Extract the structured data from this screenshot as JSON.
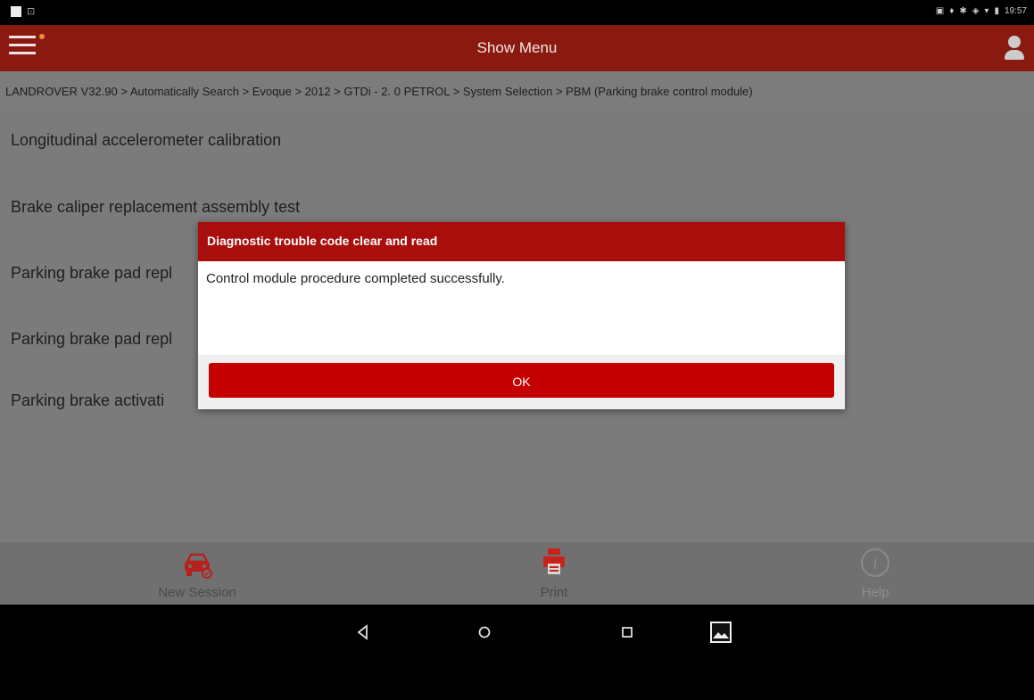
{
  "status_bar": {
    "time": "19:57"
  },
  "app_bar": {
    "title": "Show Menu"
  },
  "breadcrumb": "LANDROVER V32.90 > Automatically Search > Evoque > 2012 > GTDi - 2. 0 PETROL > System Selection > PBM (Parking brake control module)",
  "menu": {
    "items": [
      {
        "label": "Longitudinal accelerometer calibration"
      },
      {
        "label": "Brake caliper replacement assembly test"
      },
      {
        "label": "Parking brake pad repl"
      },
      {
        "label": "Parking brake pad repl"
      },
      {
        "label": "Parking brake activati"
      }
    ]
  },
  "dialog": {
    "title": "Diagnostic trouble code clear and read",
    "message": "Control module procedure completed successfully.",
    "ok_label": "OK"
  },
  "toolbar": {
    "new_session_label": "New Session",
    "print_label": "Print",
    "help_label": "Help"
  },
  "colors": {
    "app_bar": "#8a1a10",
    "dialog_header": "#a80e0b",
    "ok_button": "#c40000",
    "list_bg": "#7b7b7b"
  },
  "icons": {
    "menu": "hamburger-icon",
    "user": "user-icon",
    "new_session": "car-icon",
    "print": "printer-icon",
    "help": "info-icon"
  }
}
